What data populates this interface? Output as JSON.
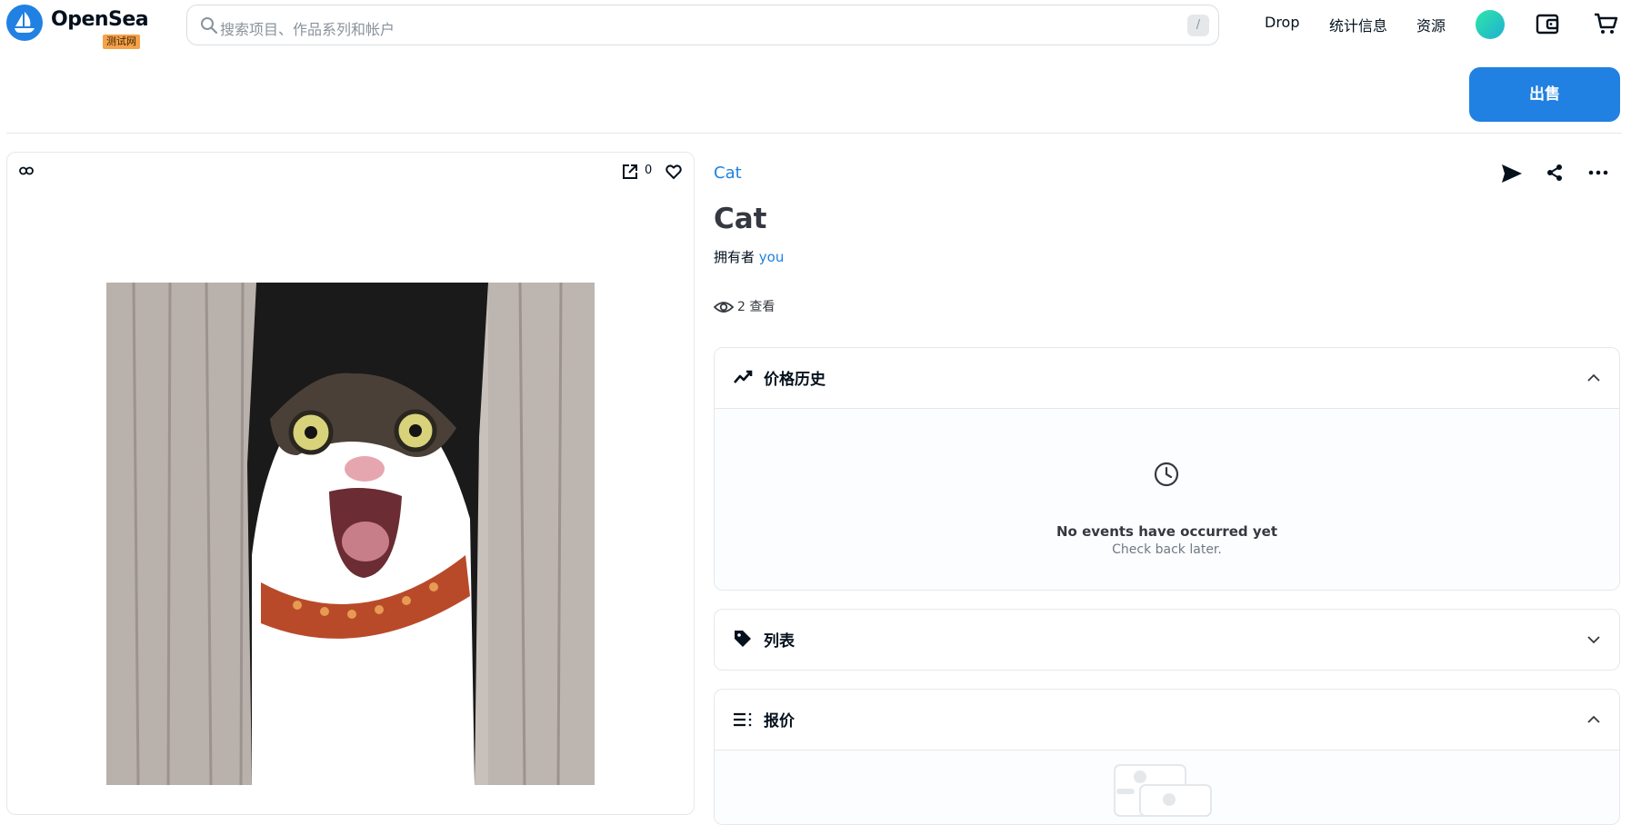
{
  "header": {
    "brand": "OpenSea",
    "badge": "测试网",
    "search_placeholder": "搜索项目、作品系列和帐户",
    "search_shortcut": "/",
    "nav": [
      {
        "label": "Drop"
      },
      {
        "label": "统计信息"
      },
      {
        "label": "资源"
      }
    ]
  },
  "actions": {
    "sell_label": "出售"
  },
  "media": {
    "favorites_count": "0"
  },
  "item": {
    "collection": "Cat",
    "title": "Cat",
    "owner_prefix": "拥有者",
    "owner_name": "you",
    "views": "2 查看"
  },
  "panels": {
    "price_history": {
      "title": "价格历史",
      "empty_title": "No events have occurred yet",
      "empty_subtitle": "Check back later.",
      "expanded": true
    },
    "listings": {
      "title": "列表",
      "expanded": false
    },
    "offers": {
      "title": "报价",
      "expanded": true
    }
  },
  "colors": {
    "brand_blue": "#2081e2",
    "badge_orange": "#f5a24a",
    "text_dark": "#04111d"
  }
}
